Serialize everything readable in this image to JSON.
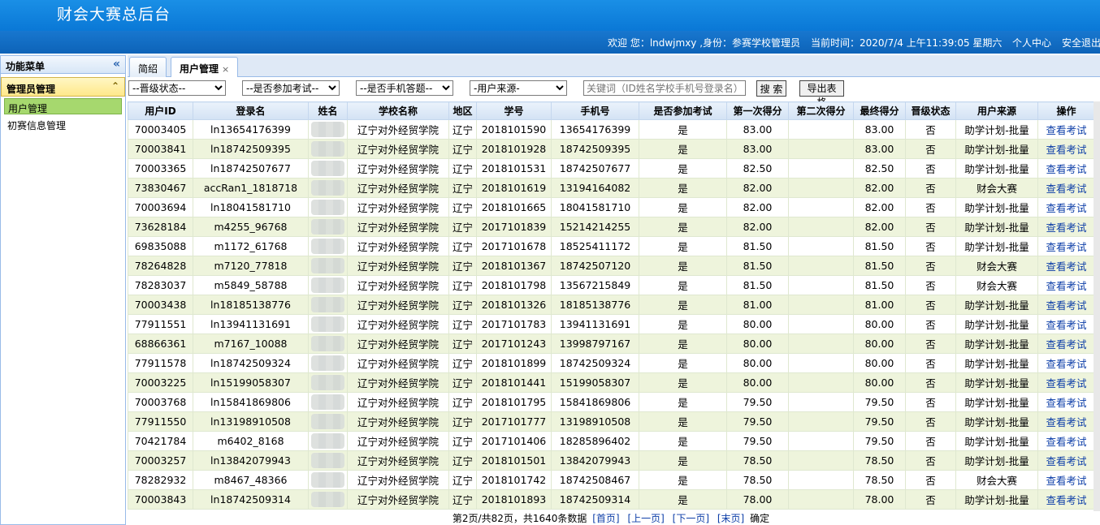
{
  "app": {
    "title": "财会大赛总后台"
  },
  "infobar": {
    "welcome": "欢迎 您：lndwjmxy ,身份：参赛学校管理员",
    "time": "当前时间：2020/7/4 上午11:39:05 星期六",
    "profile": "个人中心",
    "logout": "安全退出"
  },
  "sidebar": {
    "title": "功能菜单",
    "collapse_icon": "«",
    "group": "管理员管理",
    "group_toggle": "⌃",
    "items": [
      "用户管理",
      "初赛信息管理"
    ]
  },
  "tabs": [
    {
      "label": "简绍"
    },
    {
      "label": "用户管理",
      "close": "×"
    }
  ],
  "filters": {
    "promotion": "--晋级状态--",
    "exam": "--是否参加考试--",
    "mobile": "--是否手机答题--",
    "source": "-用户来源-",
    "keyword_placeholder": "关键词（ID姓名学校手机号登录名）",
    "search": "搜 索",
    "export": "导出表格"
  },
  "table": {
    "headers": [
      "用户ID",
      "登录名",
      "姓名",
      "学校名称",
      "地区",
      "学号",
      "手机号",
      "是否参加考试",
      "第一次得分",
      "第二次得分",
      "最终得分",
      "晋级状态",
      "用户来源",
      "操作"
    ],
    "rows": [
      [
        "70003405",
        "ln13654176399",
        "",
        "辽宁对外经贸学院",
        "辽宁",
        "2018101590",
        "13654176399",
        "是",
        "83.00",
        "",
        "83.00",
        "否",
        "助学计划-批量",
        "查看考试"
      ],
      [
        "70003841",
        "ln18742509395",
        "",
        "辽宁对外经贸学院",
        "辽宁",
        "2018101928",
        "18742509395",
        "是",
        "83.00",
        "",
        "83.00",
        "否",
        "助学计划-批量",
        "查看考试"
      ],
      [
        "70003365",
        "ln18742507677",
        "",
        "辽宁对外经贸学院",
        "辽宁",
        "2018101531",
        "18742507677",
        "是",
        "82.50",
        "",
        "82.50",
        "否",
        "助学计划-批量",
        "查看考试"
      ],
      [
        "73830467",
        "accRan1_1818718",
        "",
        "辽宁对外经贸学院",
        "辽宁",
        "2018101619",
        "13194164082",
        "是",
        "82.00",
        "",
        "82.00",
        "否",
        "财会大赛",
        "查看考试"
      ],
      [
        "70003694",
        "ln18041581710",
        "",
        "辽宁对外经贸学院",
        "辽宁",
        "2018101665",
        "18041581710",
        "是",
        "82.00",
        "",
        "82.00",
        "否",
        "助学计划-批量",
        "查看考试"
      ],
      [
        "73628184",
        "m4255_96768",
        "",
        "辽宁对外经贸学院",
        "辽宁",
        "2017101839",
        "15214214255",
        "是",
        "82.00",
        "",
        "82.00",
        "否",
        "助学计划-批量",
        "查看考试"
      ],
      [
        "69835088",
        "m1172_61768",
        "",
        "辽宁对外经贸学院",
        "辽宁",
        "2017101678",
        "18525411172",
        "是",
        "81.50",
        "",
        "81.50",
        "否",
        "助学计划-批量",
        "查看考试"
      ],
      [
        "78264828",
        "m7120_77818",
        "",
        "辽宁对外经贸学院",
        "辽宁",
        "2018101367",
        "18742507120",
        "是",
        "81.50",
        "",
        "81.50",
        "否",
        "财会大赛",
        "查看考试"
      ],
      [
        "78283037",
        "m5849_58788",
        "",
        "辽宁对外经贸学院",
        "辽宁",
        "2018101798",
        "13567215849",
        "是",
        "81.50",
        "",
        "81.50",
        "否",
        "财会大赛",
        "查看考试"
      ],
      [
        "70003438",
        "ln18185138776",
        "",
        "辽宁对外经贸学院",
        "辽宁",
        "2018101326",
        "18185138776",
        "是",
        "81.00",
        "",
        "81.00",
        "否",
        "助学计划-批量",
        "查看考试"
      ],
      [
        "77911551",
        "ln13941131691",
        "",
        "辽宁对外经贸学院",
        "辽宁",
        "2017101783",
        "13941131691",
        "是",
        "80.00",
        "",
        "80.00",
        "否",
        "助学计划-批量",
        "查看考试"
      ],
      [
        "68866361",
        "m7167_10088",
        "",
        "辽宁对外经贸学院",
        "辽宁",
        "2017101243",
        "13998797167",
        "是",
        "80.00",
        "",
        "80.00",
        "否",
        "助学计划-批量",
        "查看考试"
      ],
      [
        "77911578",
        "ln18742509324",
        "",
        "辽宁对外经贸学院",
        "辽宁",
        "2018101899",
        "18742509324",
        "是",
        "80.00",
        "",
        "80.00",
        "否",
        "助学计划-批量",
        "查看考试"
      ],
      [
        "70003225",
        "ln15199058307",
        "",
        "辽宁对外经贸学院",
        "辽宁",
        "2018101441",
        "15199058307",
        "是",
        "80.00",
        "",
        "80.00",
        "否",
        "助学计划-批量",
        "查看考试"
      ],
      [
        "70003768",
        "ln15841869806",
        "",
        "辽宁对外经贸学院",
        "辽宁",
        "2018101795",
        "15841869806",
        "是",
        "79.50",
        "",
        "79.50",
        "否",
        "助学计划-批量",
        "查看考试"
      ],
      [
        "77911550",
        "ln13198910508",
        "",
        "辽宁对外经贸学院",
        "辽宁",
        "2017101777",
        "13198910508",
        "是",
        "79.50",
        "",
        "79.50",
        "否",
        "助学计划-批量",
        "查看考试"
      ],
      [
        "70421784",
        "m6402_8168",
        "",
        "辽宁对外经贸学院",
        "辽宁",
        "2017101406",
        "18285896402",
        "是",
        "79.50",
        "",
        "79.50",
        "否",
        "助学计划-批量",
        "查看考试"
      ],
      [
        "70003257",
        "ln13842079943",
        "",
        "辽宁对外经贸学院",
        "辽宁",
        "2018101501",
        "13842079943",
        "是",
        "78.50",
        "",
        "78.50",
        "否",
        "助学计划-批量",
        "查看考试"
      ],
      [
        "78282932",
        "m8467_48366",
        "",
        "辽宁对外经贸学院",
        "辽宁",
        "2018101742",
        "18742508467",
        "是",
        "78.50",
        "",
        "78.50",
        "否",
        "财会大赛",
        "查看考试"
      ],
      [
        "70003843",
        "ln18742509314",
        "",
        "辽宁对外经贸学院",
        "辽宁",
        "2018101893",
        "18742509314",
        "是",
        "78.00",
        "",
        "78.00",
        "否",
        "助学计划-批量",
        "查看考试"
      ]
    ]
  },
  "pager": {
    "summary": "第2页/共82页，共1640条数据",
    "first": "[首页]",
    "prev": "[上一页]",
    "next": "[下一页]",
    "last": "[末页]",
    "go": "确定"
  }
}
